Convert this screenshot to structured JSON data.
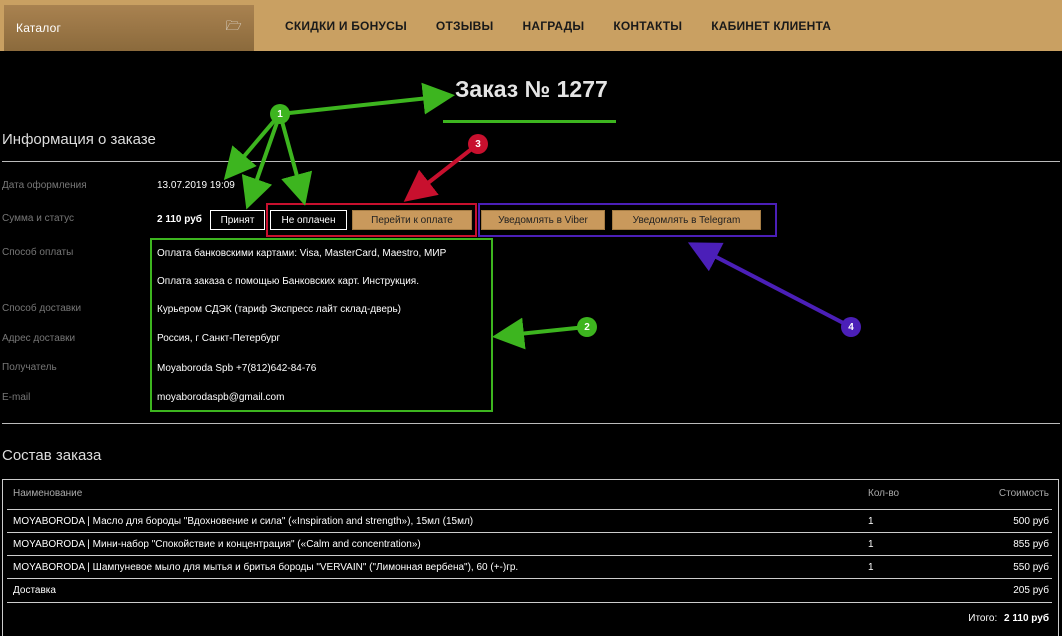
{
  "header": {
    "catalog_label": "Каталог",
    "catalog_icon": "folder-icon",
    "nav": [
      "СКИДКИ И БОНУСЫ",
      "ОТЗЫВЫ",
      "НАГРАДЫ",
      "КОНТАКТЫ",
      "КАБИНЕТ КЛИЕНТА"
    ]
  },
  "order": {
    "title": "Заказ № 1277"
  },
  "info": {
    "section_title": "Информация о заказе",
    "rows": {
      "date": {
        "label": "Дата оформления",
        "value": "13.07.2019 19:09"
      },
      "sum_status": {
        "label": "Сумма и статус",
        "value": "2 110 руб"
      },
      "payment": {
        "label": "Способ оплаты",
        "value": "Оплата банковскими картами: Visa, MasterCard, Maestro, МИР",
        "note": "Оплата заказа с помощью Банковских карт. Инструкция."
      },
      "delivery": {
        "label": "Способ доставки",
        "value": "Курьером СДЭК (тариф Экспресс лайт склад-дверь)"
      },
      "address": {
        "label": "Адрес доставки",
        "value": "Россия, г Санкт-Петербург"
      },
      "recipient": {
        "label": "Получатель",
        "value": "Moyaboroda Spb +7(812)642-84-76"
      },
      "email": {
        "label": "E-mail",
        "value": "moyaborodaspb@gmail.com"
      }
    },
    "buttons": {
      "accepted": "Принят",
      "not_paid": "Не оплачен",
      "go_to_payment": "Перейти к оплате",
      "notify_viber": "Уведомлять в Viber",
      "notify_telegram": "Уведомлять в Telegram"
    }
  },
  "annotations": {
    "markers": [
      "1",
      "2",
      "3",
      "4"
    ],
    "colors": {
      "green": "#3db51f",
      "red": "#c8102e",
      "purple": "#4b1fb8"
    }
  },
  "composition": {
    "section_title": "Состав заказа",
    "headers": {
      "name": "Наименование",
      "qty": "Кол-во",
      "cost": "Стоимость"
    },
    "items": [
      {
        "name": "MOYABORODA | Масло для бороды \"Вдохновение и сила\" («Inspiration and strength»), 15мл (15мл)",
        "qty": "1",
        "cost": "500 руб"
      },
      {
        "name": "MOYABORODA | Мини-набор \"Спокойствие и концентрация\" («Calm and concentration»)",
        "qty": "1",
        "cost": "855 руб"
      },
      {
        "name": "MOYABORODA | Шампуневое мыло для мытья и бритья бороды \"VERVAIN\" (\"Лимонная вербена\"), 60 (+-)гр.",
        "qty": "1",
        "cost": "550 руб"
      }
    ],
    "delivery": {
      "name": "Доставка",
      "cost": "205 руб"
    },
    "total": {
      "label": "Итого:",
      "value": "2 110 руб"
    }
  },
  "colors": {
    "background": "#000000",
    "gold": "#c9a062",
    "button_gold": "#c9995c"
  }
}
